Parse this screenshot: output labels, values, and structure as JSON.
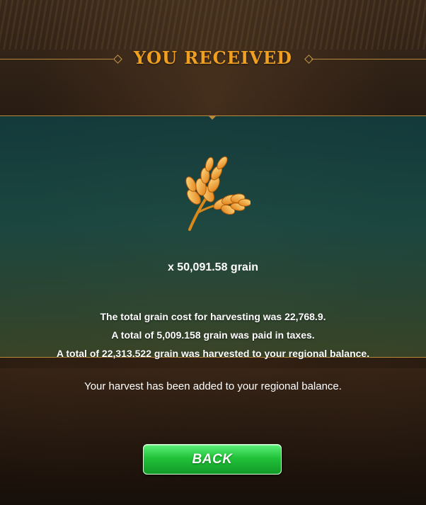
{
  "header": {
    "title": "YOU RECEIVED"
  },
  "reward": {
    "icon": "wheat-grain-icon",
    "amount_text": "x 50,091.58 grain"
  },
  "details": [
    "The total grain cost for harvesting was 22,768.9.",
    "A total of 5,009.158 grain was paid in taxes.",
    "A total of 22,313.522 grain was harvested to your regional balance."
  ],
  "note": "Your harvest has been added to your regional balance.",
  "actions": {
    "back_label": "BACK"
  },
  "colors": {
    "title": "#f0a020",
    "accent_line": "#b8893a",
    "panel": "#1c4e4a",
    "button": "#22c23a"
  }
}
